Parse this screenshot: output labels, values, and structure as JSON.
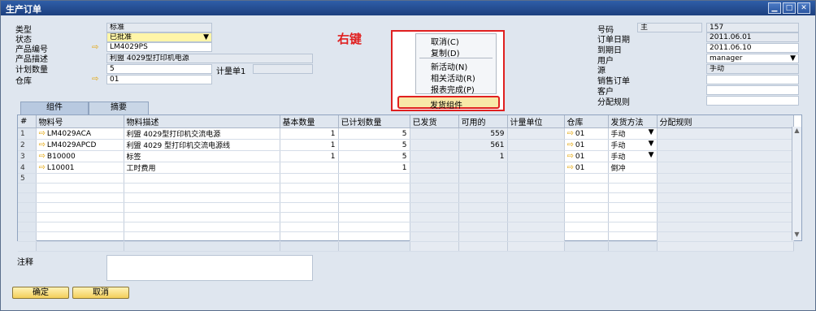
{
  "window": {
    "title": "生产订单"
  },
  "header_left": {
    "type_label": "类型",
    "type_value": "标准",
    "status_label": "状态",
    "status_value": "已批准",
    "product_no_label": "产品编号",
    "product_no_value": "LM4029PS",
    "product_desc_label": "产品描述",
    "product_desc_value": "利盟 4029型打印机电源",
    "planned_qty_label": "计划数量",
    "planned_qty_value": "5",
    "uom_label": "计量单1",
    "warehouse_label": "仓库",
    "warehouse_value": "01"
  },
  "header_right": {
    "number_label": "号码",
    "number_series": "主",
    "number_value": "157",
    "order_date_label": "订单日期",
    "order_date_value": "2011.06.01",
    "due_date_label": "到期日",
    "due_date_value": "2011.06.10",
    "user_label": "用户",
    "user_value": "manager",
    "source_label": "源",
    "source_value": "手动",
    "sales_order_label": "销售订单",
    "sales_order_value": "",
    "customer_label": "客户",
    "customer_value": "",
    "dist_rule_label": "分配规则",
    "dist_rule_value": ""
  },
  "annotation": "右键",
  "context_menu": {
    "items": [
      "取消(C)",
      "复制(D)",
      "新活动(N)",
      "相关活动(R)",
      "报表完成(P)"
    ],
    "highlighted": "发货组件"
  },
  "tabs": [
    "组件",
    "摘要"
  ],
  "grid": {
    "columns": [
      "#",
      "物料号",
      "物料描述",
      "基本数量",
      "已计划数量",
      "已发货",
      "可用的",
      "计量单位",
      "仓库",
      "发货方法",
      "分配规则"
    ],
    "rows": [
      {
        "n": "1",
        "item": "LM4029ACA",
        "desc": "利盟 4029型打印机交流电源",
        "base": "1",
        "planned": "5",
        "issued": "",
        "avail": "559",
        "uom": "",
        "wh": "01",
        "method": "手动",
        "rule": ""
      },
      {
        "n": "2",
        "item": "LM4029APCD",
        "desc": "利盟 4029 型打印机交流电源线",
        "base": "1",
        "planned": "5",
        "issued": "",
        "avail": "561",
        "uom": "",
        "wh": "01",
        "method": "手动",
        "rule": ""
      },
      {
        "n": "3",
        "item": "B10000",
        "desc": "标签",
        "base": "1",
        "planned": "5",
        "issued": "",
        "avail": "1",
        "uom": "",
        "wh": "01",
        "method": "手动",
        "rule": ""
      },
      {
        "n": "4",
        "item": "L10001",
        "desc": "工时费用",
        "base": "",
        "planned": "1",
        "issued": "",
        "avail": "",
        "uom": "",
        "wh": "01",
        "method": "倒冲",
        "rule": ""
      },
      {
        "n": "5",
        "item": "",
        "desc": "",
        "base": "",
        "planned": "",
        "issued": "",
        "avail": "",
        "uom": "",
        "wh": "",
        "method": "",
        "rule": ""
      }
    ]
  },
  "remarks_label": "注释",
  "buttons": {
    "ok": "确定",
    "cancel": "取消"
  }
}
